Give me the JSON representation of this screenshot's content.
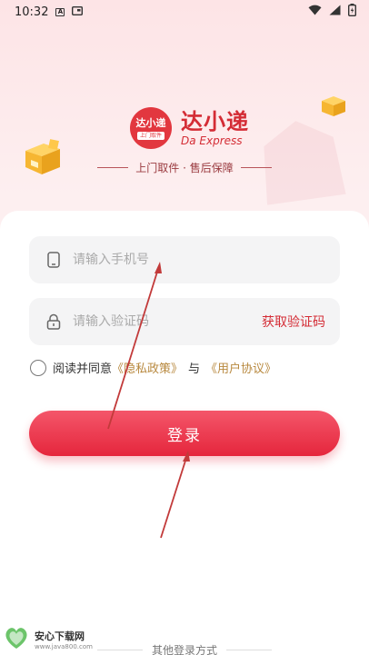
{
  "status_bar": {
    "time": "10:32",
    "icon_a": "A"
  },
  "brand": {
    "logo_main": "达小递",
    "logo_sub": "上门取件",
    "name_cn": "达小递",
    "name_en": "Da Express",
    "tagline": "上门取件 · 售后保障"
  },
  "form": {
    "phone_placeholder": "请输入手机号",
    "code_placeholder": "请输入验证码",
    "get_code_label": "获取验证码",
    "agree_prefix": "阅读并同意",
    "privacy_link": "《隐私政策》",
    "and_text": "与",
    "user_agreement_link": "《用户协议》",
    "login_label": "登录"
  },
  "other_login": "其他登录方式",
  "watermark": {
    "name": "安心下载网",
    "url": "www.java800.com"
  },
  "colors": {
    "accent": "#e2373f",
    "link": "#b8893f"
  }
}
